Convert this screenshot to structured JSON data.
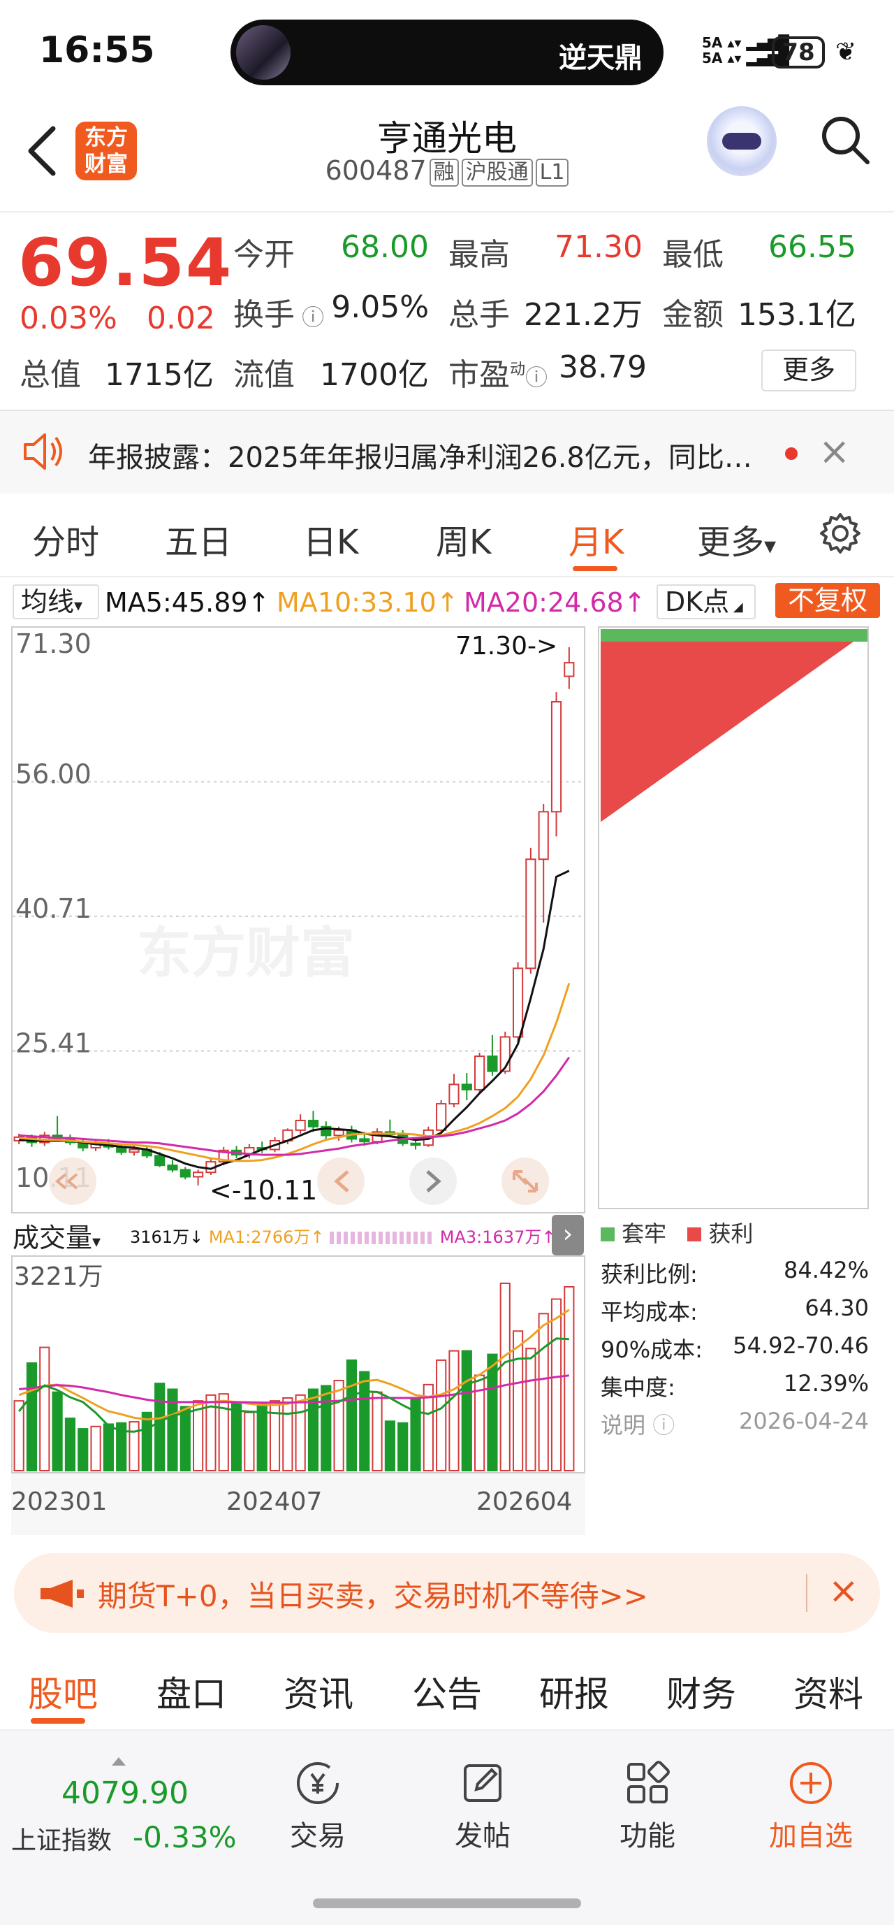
{
  "status": {
    "time": "16:55",
    "music_title": "逆天鼎",
    "signal": "5A 5A",
    "battery": "78"
  },
  "header": {
    "logo_line1": "东方",
    "logo_line2": "财富",
    "stock_name": "亨通光电",
    "stock_code": "600487",
    "tags": [
      "融",
      "沪股通",
      "L1"
    ]
  },
  "quote": {
    "price": "69.54",
    "change_pct": "0.03%",
    "change": "0.02",
    "open_label": "今开",
    "open": "68.00",
    "high_label": "最高",
    "high": "71.30",
    "low_label": "最低",
    "low": "66.55",
    "turnover_label": "换手",
    "turnover": "9.05%",
    "volume_label": "总手",
    "volume": "221.2万",
    "amount_label": "金额",
    "amount": "153.1亿",
    "mktcap_label": "总值",
    "mktcap": "1715亿",
    "float_label": "流值",
    "float_cap": "1700亿",
    "pe_label": "市盈",
    "pe_sup": "动",
    "pe": "38.79",
    "more_label": "更多"
  },
  "notice": {
    "text": "年报披露：2025年年报归属净利润26.8亿元，同比…",
    "close": "×"
  },
  "chart_tabs": {
    "items": [
      "分时",
      "五日",
      "日K",
      "周K",
      "月K",
      "更多"
    ],
    "active": "月K",
    "more_caret": "▾"
  },
  "ma": {
    "select": "均线",
    "ma5": "MA5:45.89↑",
    "ma10": "MA10:33.10↑",
    "ma20": "MA20:24.68↑",
    "dk": "DK点",
    "adjust": "不复权",
    "colors": {
      "ma5": "#111111",
      "ma10": "#f0a020",
      "ma20": "#d22aa8",
      "ma60": "#1a9a2a"
    }
  },
  "kline": {
    "y_labels": [
      "71.30",
      "56.00",
      "40.71",
      "25.41",
      "10.11"
    ],
    "high_marker": "71.30->",
    "low_marker": "<-10.11",
    "watermark": "东方财富"
  },
  "chip": {
    "legend_trapped": "套牢",
    "legend_profit": "获利",
    "rows": [
      {
        "label": "获利比例:",
        "value": "84.42%"
      },
      {
        "label": "平均成本:",
        "value": "64.30"
      },
      {
        "label": "90%成本:",
        "value": "54.92-70.46"
      },
      {
        "label": "集中度:",
        "value": "12.39%"
      },
      {
        "label": "说明",
        "value": "2026-04-24"
      }
    ],
    "profit_ratio": 0.8442
  },
  "volume": {
    "select": "成交量",
    "vol": "3161万↓",
    "ma1": "MA1:2766万↑",
    "ma3": "MA3:1637万↑",
    "max_label": "3221万",
    "x_labels": [
      "202301",
      "202407",
      "202604"
    ]
  },
  "banner": {
    "text": "期货T+0，当日买卖，交易时机不等待>>",
    "close": "×"
  },
  "bottom_tabs": {
    "items": [
      "股吧",
      "盘口",
      "资讯",
      "公告",
      "研报",
      "财务",
      "资料"
    ],
    "active": "股吧"
  },
  "bottom_nav": {
    "index_value": "4079.90",
    "index_name": "上证指数",
    "index_pct": "-0.33%",
    "items": [
      {
        "label": "交易",
        "icon": "yen-icon"
      },
      {
        "label": "发帖",
        "icon": "edit-icon"
      },
      {
        "label": "功能",
        "icon": "grid-icon"
      },
      {
        "label": "加自选",
        "icon": "add-circle-icon"
      }
    ]
  },
  "chart_data": {
    "type": "candlestick",
    "ylim": [
      10.11,
      71.3
    ],
    "y_ticks": [
      "71.30",
      "56.00",
      "40.71",
      "25.41",
      "10.11"
    ],
    "x_labels": [
      "202301",
      "202407",
      "202604"
    ],
    "candles": [
      [
        15.2,
        16.0,
        14.8,
        15.6
      ],
      [
        15.6,
        15.9,
        14.5,
        15.0
      ],
      [
        15.0,
        16.2,
        14.6,
        15.8
      ],
      [
        15.8,
        18.0,
        15.2,
        15.5
      ],
      [
        15.5,
        15.9,
        14.7,
        15.0
      ],
      [
        15.0,
        15.4,
        14.0,
        14.4
      ],
      [
        14.4,
        15.2,
        14.0,
        14.9
      ],
      [
        14.9,
        15.4,
        14.2,
        14.5
      ],
      [
        14.5,
        14.9,
        13.6,
        13.9
      ],
      [
        13.9,
        14.6,
        13.5,
        14.2
      ],
      [
        14.2,
        14.6,
        13.2,
        13.5
      ],
      [
        13.5,
        13.9,
        12.2,
        12.4
      ],
      [
        12.4,
        13.0,
        11.6,
        11.9
      ],
      [
        11.9,
        12.2,
        10.8,
        11.1
      ],
      [
        11.1,
        11.9,
        10.11,
        11.6
      ],
      [
        11.6,
        13.2,
        11.3,
        12.8
      ],
      [
        12.8,
        14.5,
        12.4,
        14.1
      ],
      [
        14.1,
        14.6,
        13.2,
        13.6
      ],
      [
        13.6,
        14.8,
        13.2,
        14.4
      ],
      [
        14.4,
        15.1,
        13.8,
        14.2
      ],
      [
        14.2,
        15.6,
        13.9,
        15.2
      ],
      [
        15.2,
        16.6,
        14.8,
        16.4
      ],
      [
        16.4,
        18.2,
        16.0,
        17.5
      ],
      [
        17.5,
        18.6,
        16.2,
        16.8
      ],
      [
        16.8,
        17.4,
        15.4,
        15.8
      ],
      [
        15.8,
        16.8,
        15.2,
        16.4
      ],
      [
        16.4,
        16.9,
        15.0,
        15.4
      ],
      [
        15.4,
        16.2,
        14.6,
        15.1
      ],
      [
        15.1,
        16.6,
        14.8,
        16.2
      ],
      [
        16.2,
        17.6,
        15.6,
        15.9
      ],
      [
        15.9,
        16.4,
        14.6,
        14.9
      ],
      [
        14.9,
        15.5,
        14.2,
        14.7
      ],
      [
        14.7,
        16.8,
        14.5,
        16.4
      ],
      [
        16.4,
        19.8,
        16.0,
        19.4
      ],
      [
        19.4,
        22.8,
        19.0,
        21.6
      ],
      [
        21.6,
        22.9,
        19.8,
        21.0
      ],
      [
        21.0,
        25.2,
        20.6,
        24.8
      ],
      [
        24.8,
        27.2,
        22.6,
        23.1
      ],
      [
        23.1,
        27.6,
        22.8,
        27.0
      ],
      [
        27.0,
        35.5,
        26.4,
        34.8
      ],
      [
        34.8,
        48.5,
        34.2,
        47.2
      ],
      [
        47.2,
        53.5,
        40.0,
        52.6
      ],
      [
        52.6,
        66.2,
        49.8,
        65.1
      ],
      [
        68.0,
        71.3,
        66.55,
        69.54
      ]
    ],
    "ma5": [
      15.3,
      15.2,
      15.2,
      15.2,
      15.2,
      15.0,
      14.8,
      14.7,
      14.5,
      14.4,
      14.2,
      13.7,
      13.2,
      12.6,
      12.2,
      12.0,
      12.6,
      13.0,
      13.6,
      14.2,
      14.7,
      15.2,
      15.8,
      16.4,
      16.6,
      16.5,
      16.4,
      16.0,
      15.8,
      15.7,
      15.5,
      15.3,
      15.4,
      16.1,
      17.6,
      19.0,
      20.6,
      22.0,
      23.5,
      26.2,
      31.4,
      37.0,
      45.2,
      45.89
    ],
    "ma10": [
      15.5,
      15.4,
      15.3,
      15.3,
      15.2,
      15.1,
      15.0,
      14.9,
      14.8,
      14.7,
      14.6,
      14.4,
      14.1,
      13.8,
      13.5,
      13.2,
      13.0,
      12.9,
      12.9,
      13.0,
      13.3,
      13.7,
      14.2,
      14.8,
      15.3,
      15.6,
      15.9,
      16.0,
      16.0,
      16.0,
      16.0,
      15.9,
      15.7,
      15.8,
      16.2,
      16.6,
      17.2,
      18.0,
      18.9,
      20.2,
      22.2,
      24.9,
      28.6,
      33.1
    ],
    "ma20": [
      15.8,
      15.7,
      15.6,
      15.5,
      15.5,
      15.4,
      15.3,
      15.2,
      15.1,
      15.0,
      15.0,
      14.9,
      14.7,
      14.5,
      14.3,
      14.1,
      13.9,
      13.8,
      13.7,
      13.6,
      13.6,
      13.6,
      13.7,
      13.9,
      14.1,
      14.3,
      14.6,
      14.8,
      15.0,
      15.2,
      15.4,
      15.5,
      15.6,
      15.7,
      15.9,
      16.2,
      16.6,
      17.0,
      17.5,
      18.3,
      19.4,
      20.8,
      22.6,
      24.68
    ],
    "volume": [
      1200,
      1850,
      2120,
      1350,
      900,
      720,
      760,
      800,
      820,
      840,
      1000,
      1500,
      1400,
      1100,
      1200,
      1300,
      1320,
      1150,
      1000,
      1150,
      1200,
      1250,
      1300,
      1400,
      1460,
      1550,
      1900,
      1700,
      1350,
      850,
      820,
      1250,
      1480,
      1900,
      2060,
      2060,
      1640,
      2000,
      3221,
      2400,
      2100,
      2700,
      2950,
      3161
    ],
    "volume_ma1": [
      1300,
      1380,
      1460,
      1480,
      1360,
      1250,
      1130,
      1020,
      970,
      910,
      880,
      900,
      960,
      1060,
      1140,
      1180,
      1200,
      1180,
      1150,
      1130,
      1130,
      1150,
      1200,
      1250,
      1320,
      1380,
      1460,
      1540,
      1560,
      1490,
      1400,
      1300,
      1270,
      1310,
      1400,
      1540,
      1650,
      1800,
      1980,
      2130,
      2300,
      2500,
      2620,
      2766
    ],
    "volume_ma3": [
      1400,
      1420,
      1450,
      1470,
      1460,
      1430,
      1390,
      1350,
      1300,
      1260,
      1220,
      1190,
      1180,
      1180,
      1180,
      1180,
      1180,
      1180,
      1175,
      1170,
      1170,
      1170,
      1175,
      1180,
      1190,
      1200,
      1220,
      1240,
      1250,
      1250,
      1250,
      1250,
      1260,
      1280,
      1310,
      1340,
      1380,
      1420,
      1470,
      1510,
      1550,
      1580,
      1610,
      1637
    ]
  }
}
